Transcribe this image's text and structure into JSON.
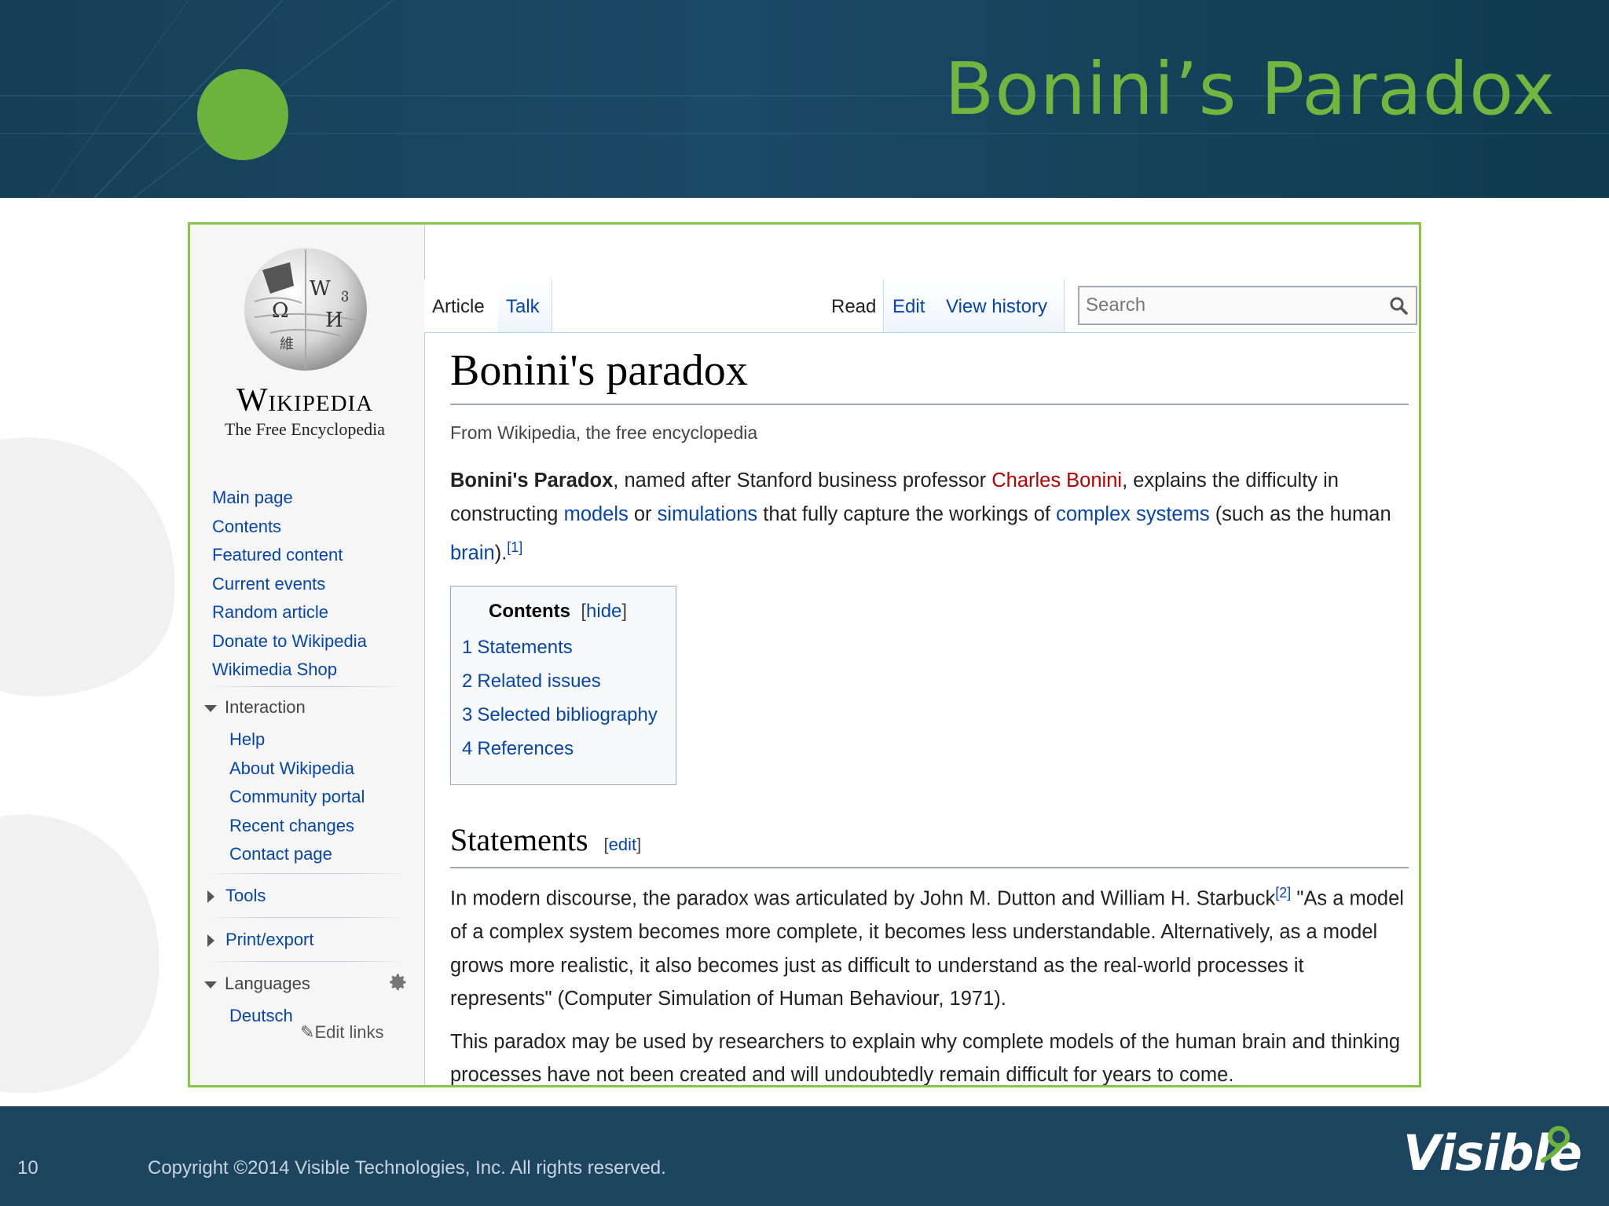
{
  "slide": {
    "title": "Bonini’s Paradox",
    "page_number": "10",
    "copyright": "Copyright ©2014 Visible Technologies, Inc.  All rights reserved.",
    "brand": "Visible",
    "colors": {
      "title_green": "#72b53f",
      "header_bg": "#173e58",
      "frame_border": "#88c34a"
    }
  },
  "wiki": {
    "wordmark": "Wikipedia",
    "tagline": "The Free Encyclopedia",
    "logo_icon": "wikipedia-globe-icon",
    "nav": [
      "Main page",
      "Contents",
      "Featured content",
      "Current events",
      "Random article",
      "Donate to Wikipedia",
      "Wikimedia Shop"
    ],
    "interaction": {
      "heading": "Interaction",
      "items": [
        "Help",
        "About Wikipedia",
        "Community portal",
        "Recent changes",
        "Contact page"
      ]
    },
    "tools": "Tools",
    "print_export": "Print/export",
    "languages": {
      "heading": "Languages",
      "items": [
        "Deutsch"
      ],
      "edit_links": "Edit links"
    },
    "tabs": {
      "article": "Article",
      "talk": "Talk",
      "read": "Read",
      "edit": "Edit",
      "view_history": "View history"
    },
    "search": {
      "placeholder": "Search"
    },
    "article": {
      "heading": "Bonini's paradox",
      "site_sub": "From Wikipedia, the free encyclopedia",
      "lead": {
        "bold": "Bonini's Paradox",
        "t1": ", named after Stanford business professor ",
        "link_bonini": "Charles Bonini",
        "t2": ", explains the difficulty in constructing ",
        "link_models": "models",
        "t3": " or ",
        "link_simulations": "simulations",
        "t4": " that fully capture the workings of ",
        "link_complex": "complex systems",
        "t5": " (such as the human ",
        "link_brain": "brain",
        "t6": ").",
        "ref1": "[1]"
      },
      "toc": {
        "title": "Contents",
        "hide": "hide",
        "items": [
          {
            "num": "1",
            "label": "Statements"
          },
          {
            "num": "2",
            "label": "Related issues"
          },
          {
            "num": "3",
            "label": "Selected bibliography"
          },
          {
            "num": "4",
            "label": "References"
          }
        ]
      },
      "section": {
        "heading": "Statements",
        "edit": "edit",
        "p1_a": "In modern discourse, the paradox was articulated by John M. Dutton and William H. Starbuck",
        "ref2": "[2]",
        "p1_b": " \"As a model of a complex system becomes more complete, it becomes less understandable. Alternatively, as a model grows more realistic, it also becomes just as difficult to understand as the real-world processes it represents\" (Computer Simulation of Human Behaviour, 1971).",
        "p2": "This paradox may be used by researchers to explain why complete models of the human brain and thinking processes have not been created and will undoubtedly remain difficult for years to come."
      }
    }
  }
}
